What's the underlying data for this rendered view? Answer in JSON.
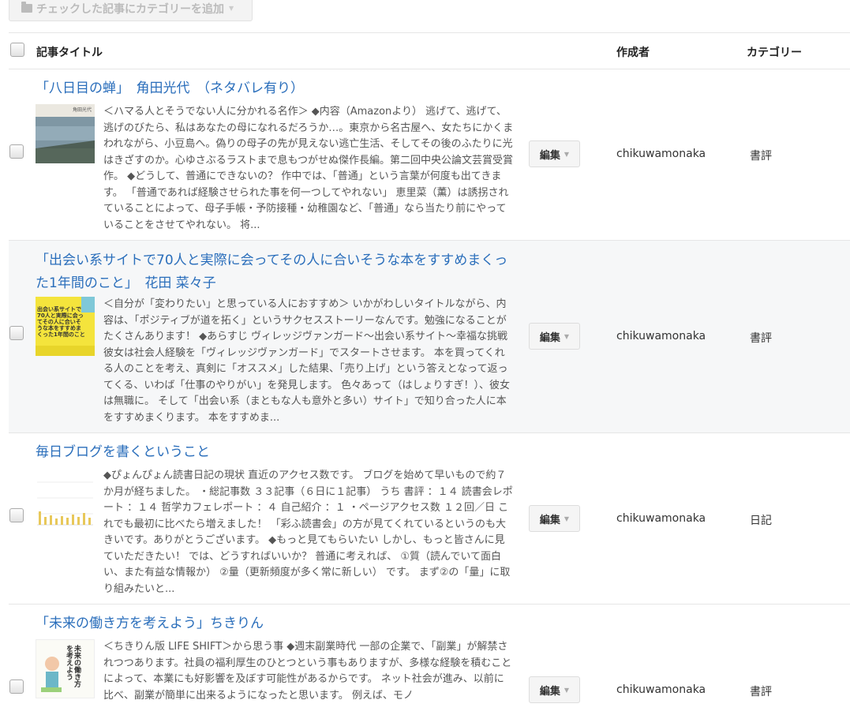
{
  "toolbar": {
    "add_category_label": "チェックした記事にカテゴリーを追加"
  },
  "table": {
    "headers": {
      "title": "記事タイトル",
      "author": "作成者",
      "category": "カテゴリー"
    }
  },
  "articles": [
    {
      "title": "「八日目の蝉」　角田光代　（ネタバレ有り）",
      "thumb_text": "角田光代",
      "excerpt": "＜ハマる人とそうでない人に分かれる名作＞ ◆内容（Amazonより） 逃げて、逃げて、逃げのびたら、私はあなたの母になれるだろうか…。東京から名古屋へ、女たちにかくまわれながら、小豆島へ。偽りの母子の先が見えない逃亡生活、そしてその後のふたりに光はきざすのか。心ゆさぶるラストまで息もつがせぬ傑作長編。第二回中央公論文芸賞受賞作。 ◆どうして、普通にできないの？ 作中では、「普通」という言葉が何度も出てきます。 「普通であれば経験させられた事を何一つしてやれない」 恵里菜（薫）は誘拐されていることによって、母子手帳・予防接種・幼稚園など、「普通」なら当たり前にやっていることをさせてやれない。 将...",
      "edit_label": "編集",
      "author": "chikuwamonaka",
      "category": "書評"
    },
    {
      "title": "「出会い系サイトで70人と実際に会ってその人に合いそうな本をすすめまくった1年間のこと」　花田 菜々子",
      "thumb_text": "出会い系サイトで70人と実際に会ってその人に合いそうな本をすすめまくった1年間のこと",
      "excerpt": "＜自分が「変わりたい」と思っている人におすすめ＞ いかがわしいタイトルながら、内容は、「ポジティブが道を拓く」というサクセスストーリーなんです。勉強になることがたくさんあります！ ◆あらすじ ヴィレッジヴァンガード〜出会い系サイト〜幸福な挑戦 彼女は社会人経験を「ヴィレッジヴァンガード」でスタートさせます。 本を買ってくれる人のことを考え、真剣に「オススメ」した結果、「売り上げ」という答えとなって返ってくる、いわば「仕事のやりがい」を発見します。 色々あって（はしょりすぎ！）、彼女は無職に。 そして「出会い系（まともな人も意外と多い）サイト」で知り合った人に本をすすめまくります。 本をすすめま...",
      "edit_label": "編集",
      "author": "chikuwamonaka",
      "category": "書評"
    },
    {
      "title": "毎日ブログを書くということ",
      "thumb_text": "",
      "excerpt": "◆ぴょんぴょん読書日記の現状 直近のアクセス数です。 ブログを始めて早いもので約７か月が経ちました。 ・総記事数 ３３記事（６日に１記事） うち 書評 ：１４ 読書会レポート ：１４ 哲学カフェレポート ：４ 自己紹介 ：１ ・ページアクセス数 １２回／日 これでも最初に比べたら増えました！ 「彩ふ読書会」の方が見てくれているというのも大きいです。ありがとうございます。 ◆もっと見てもらいたい しかし、もっと皆さんに見ていただきたい！ では、どうすればいいか？ 普通に考えれば、 ①質（読んでいて面白い、また有益な情報か） ②量（更新頻度が多く常に新しい） です。 まず②の「量」に取り組みたいと...",
      "edit_label": "編集",
      "author": "chikuwamonaka",
      "category": "日記"
    },
    {
      "title": "「未来の働き方を考えよう」ちきりん",
      "thumb_text": "未来の働き方を考えよう",
      "excerpt": "＜ちきりん版 LIFE SHIFT＞から思う事 ◆週末副業時代 一部の企業で、「副業」が解禁されつつあります。社員の福利厚生のひとつという事もありますが、多様な経験を積むことによって、本業にも好影響を及ぼす可能性があるからです。 ネット社会が進み、以前に比べ、副業が簡単に出来るようになったと思います。 例えば、モノ",
      "edit_label": "編集",
      "author": "chikuwamonaka",
      "category": "書評"
    }
  ]
}
